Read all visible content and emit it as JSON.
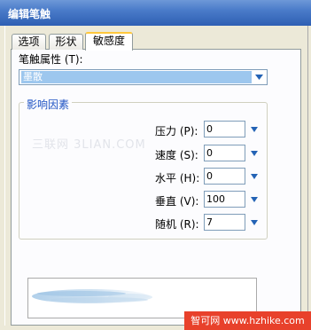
{
  "window": {
    "title": "编辑笔触"
  },
  "tabs": [
    {
      "label": "选项",
      "active": false
    },
    {
      "label": "形状",
      "active": false
    },
    {
      "label": "敏感度",
      "active": true
    }
  ],
  "tip_attribute": {
    "label": "笔触属性 (T):",
    "value": "墨散"
  },
  "influence_group": {
    "title": "影响因素",
    "rows": [
      {
        "label": "压力 (P):",
        "value": "0"
      },
      {
        "label": "速度 (S):",
        "value": "0"
      },
      {
        "label": "水平 (H):",
        "value": "0"
      },
      {
        "label": "垂直 (V):",
        "value": "100"
      },
      {
        "label": "随机 (R):",
        "value": "7"
      }
    ]
  },
  "watermark": "三联网 3LIAN.COM",
  "site_badge": "智可网 www.hzhike.com",
  "colors": {
    "title_bar": "#2e5fb3",
    "selection": "#9dc7ee",
    "arrow": "#2463b5",
    "active_tab_top": "#ffc83c",
    "badge": "#e8412b"
  }
}
